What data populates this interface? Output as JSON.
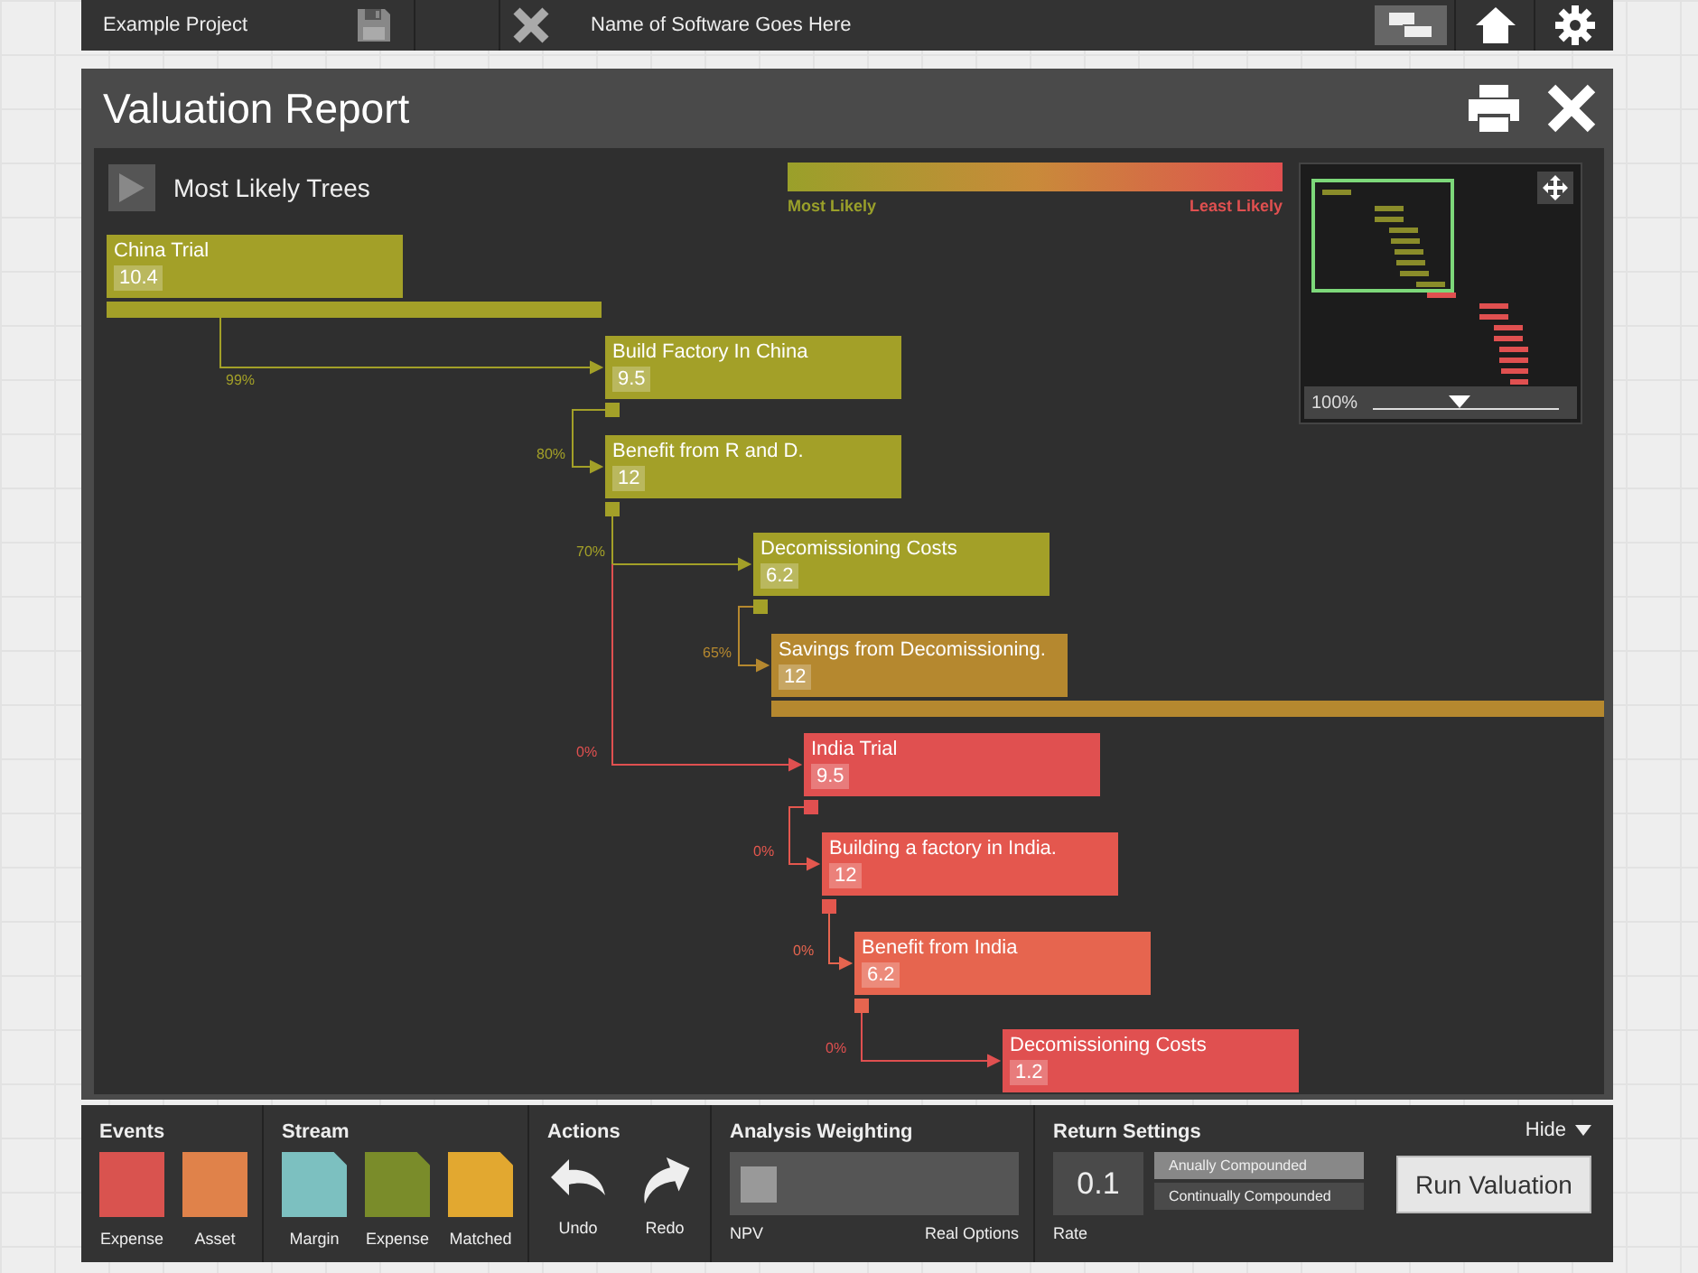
{
  "top_bar": {
    "project": "Example Project",
    "software_name": "Name of Software Goes Here",
    "buttons": [
      {
        "kind": "tree",
        "selected": true
      },
      {
        "kind": "home",
        "selected": false
      },
      {
        "kind": "settings",
        "selected": false
      }
    ]
  },
  "report": {
    "title": "Valuation Report",
    "tree_panel": {
      "title": "Most Likely Trees",
      "legend": {
        "low_label": "Most Likely",
        "high_label": "Least Likely"
      },
      "tree": [
        {
          "label": "China Trial",
          "value": "10.4",
          "color": "#a3a028",
          "path_bar": true,
          "children": [
            {
              "label": "Build Factory In China",
              "value": "9.5",
              "color": "#a3a028",
              "probability": "99%",
              "children": [
                {
                  "label": "Benefit from R and D.",
                  "value": "12",
                  "color": "#a3a028",
                  "probability": "80%",
                  "children": [
                    {
                      "label": "Decomissioning Costs",
                      "value": "6.2",
                      "color": "#a3a028",
                      "probability": "70%",
                      "children": [
                        {
                          "label": "Savings from Decomissioning.",
                          "value": "12",
                          "color": "#b5882f",
                          "probability": "65%",
                          "path_bar": true
                        }
                      ]
                    },
                    {
                      "label": "India Trial",
                      "value": "9.5",
                      "color": "#e05050",
                      "probability": "0%",
                      "children": [
                        {
                          "label": "Building a factory in India.",
                          "value": "12",
                          "color": "#e4574e",
                          "probability": "0%",
                          "children": [
                            {
                              "label": "Benefit from India",
                              "value": "6.2",
                              "color": "#e6654f",
                              "probability": "0%",
                              "children": [
                                {
                                  "label": "Decomissioning Costs",
                                  "value": "1.2",
                                  "color": "#e05050",
                                  "probability": "0%"
                                }
                              ]
                            }
                          ]
                        }
                      ]
                    }
                  ]
                }
              ]
            }
          ]
        }
      ],
      "minimap": {
        "zoom": "100%",
        "level": 0.47
      }
    }
  },
  "bottom_panel": {
    "events": {
      "title": "Events",
      "items": [
        {
          "label": "Expense",
          "color": "#d9534f"
        },
        {
          "label": "Asset",
          "color": "#e0824a"
        }
      ]
    },
    "stream": {
      "title": "Stream",
      "items": [
        {
          "label": "Margin",
          "color": "#7cc0c0"
        },
        {
          "label": "Expense",
          "color": "#7a8c2a"
        },
        {
          "label": "Matched",
          "color": "#e2a830"
        }
      ]
    },
    "actions": {
      "title": "Actions",
      "items": [
        {
          "kind": "undo",
          "label": "Undo"
        },
        {
          "kind": "redo",
          "label": "Redo"
        }
      ]
    },
    "weighting": {
      "title": "Analysis Weighting",
      "level": 0,
      "min_label": "NPV",
      "max_label": "Real Options"
    },
    "return_settings": {
      "title": "Return Settings",
      "rate": "0.1",
      "rate_label": "Rate",
      "options": [
        {
          "label": "Anually Compounded",
          "selected": true
        },
        {
          "label": "Continually Compounded",
          "selected": false
        }
      ]
    },
    "hide": "Hide",
    "run_button": "Run Valuation"
  }
}
